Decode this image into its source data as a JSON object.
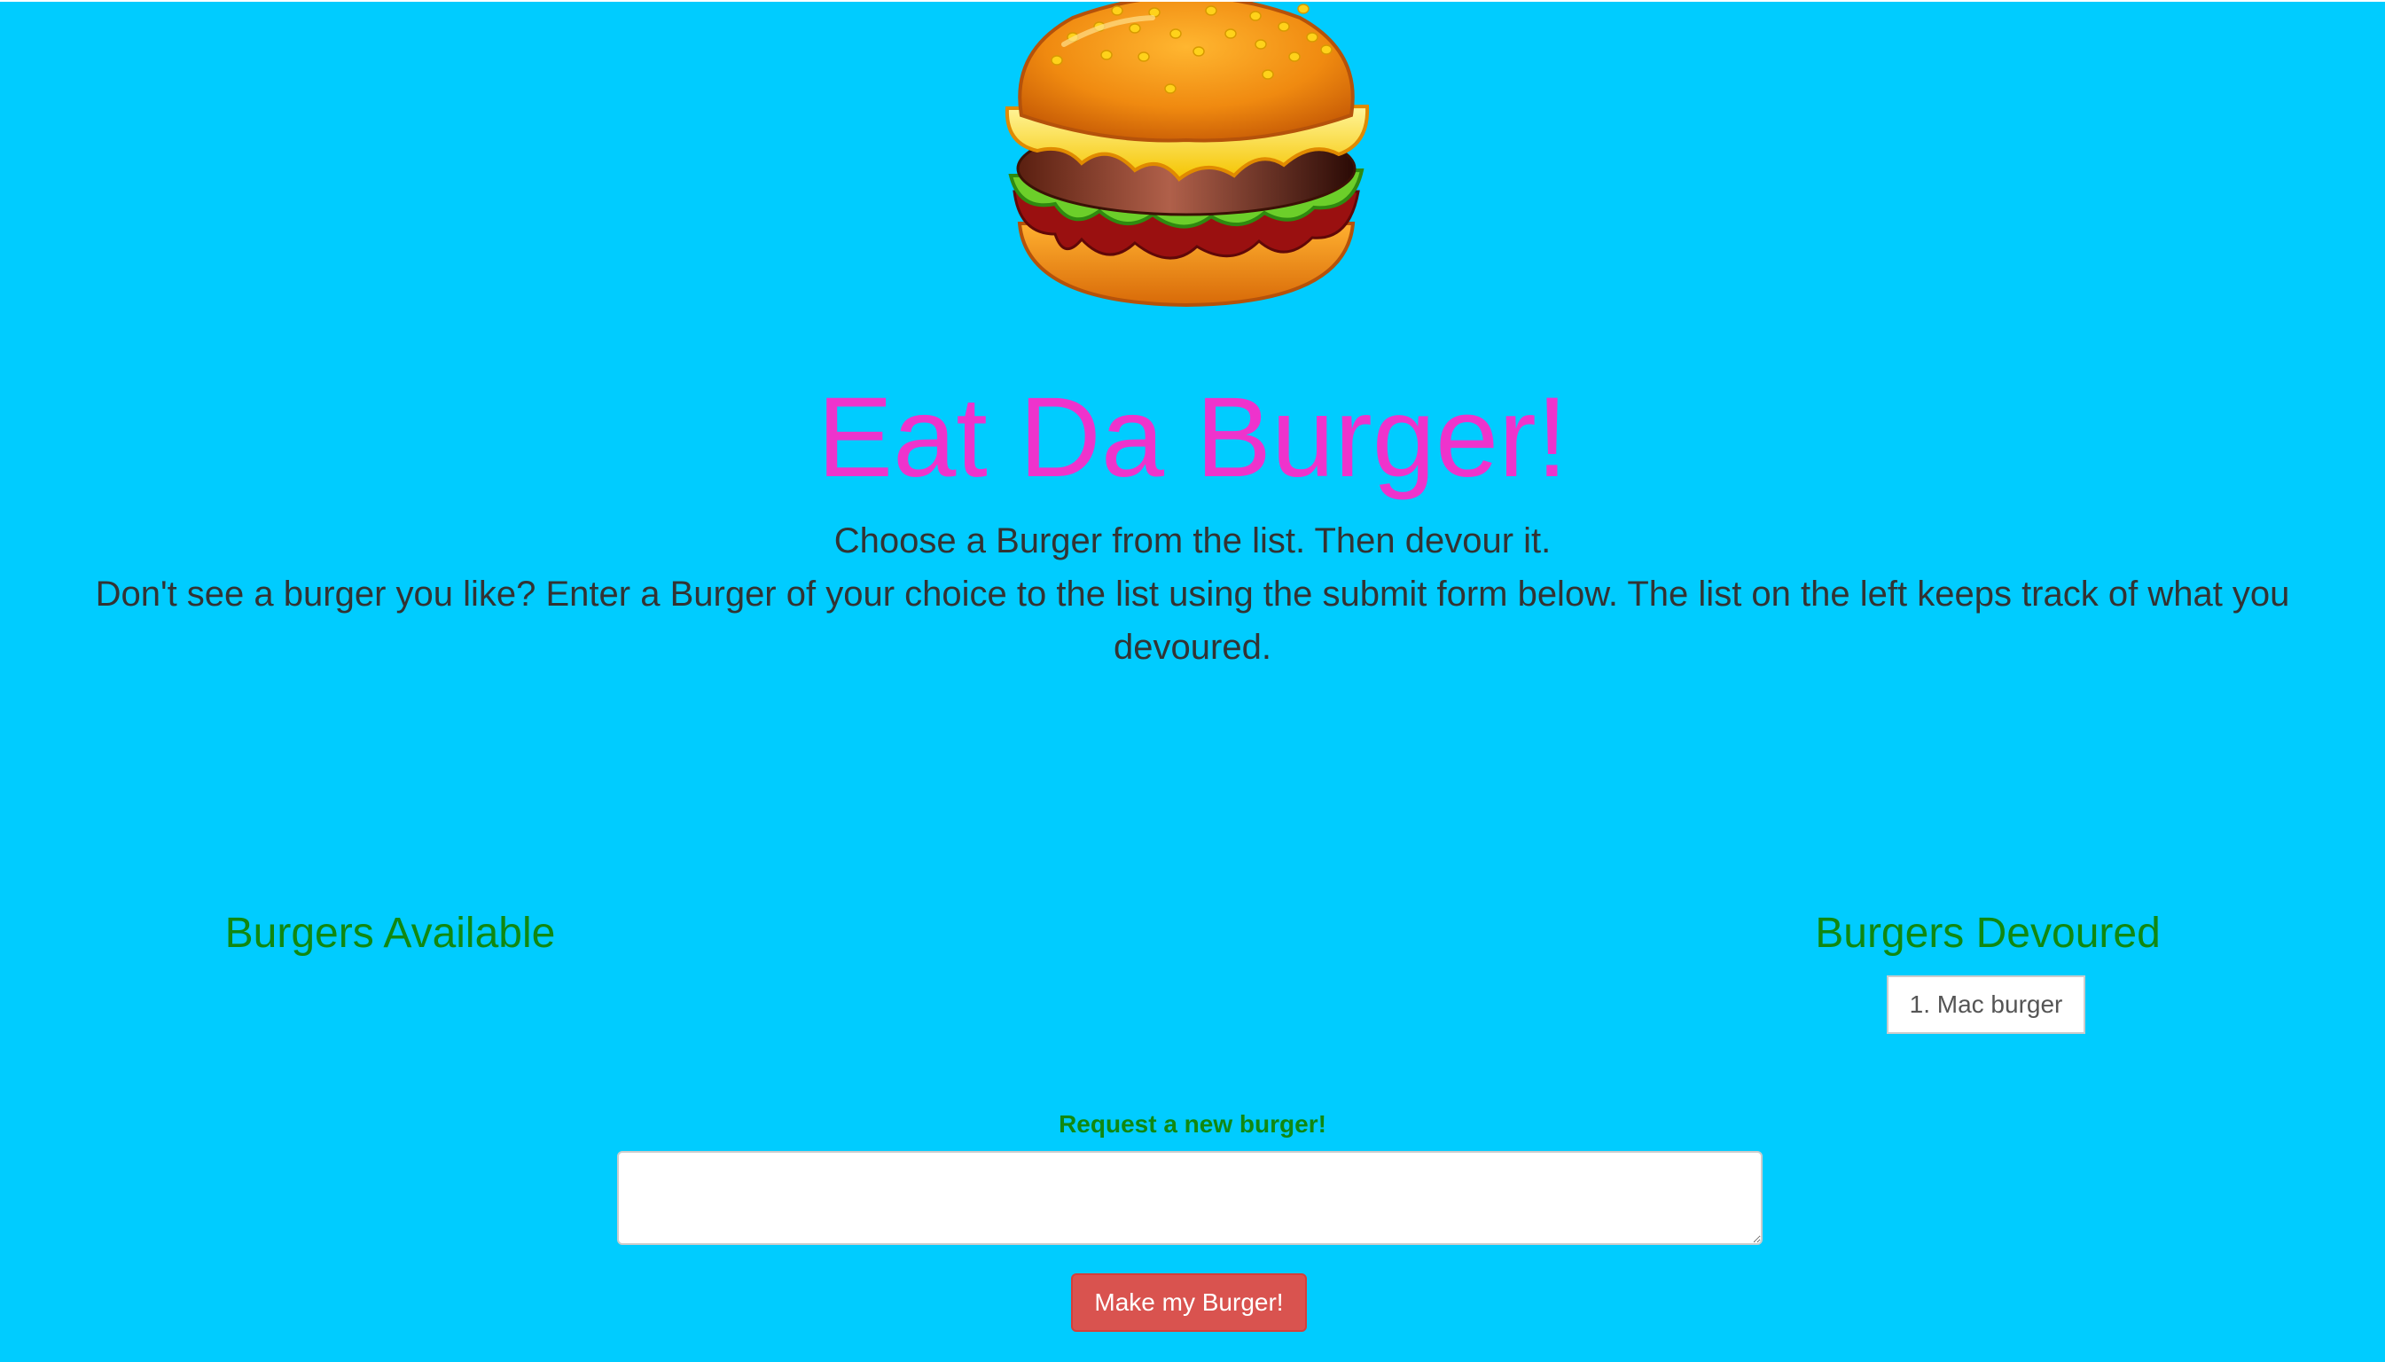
{
  "colors": {
    "background": "#00ccff",
    "title": "#ee33cc",
    "heading": "#118811",
    "button": "#d9534f"
  },
  "hero": {
    "icon": "burger-icon"
  },
  "header": {
    "title": "Eat Da Burger!",
    "intro_line1": "Choose a Burger from the list. Then devour it.",
    "intro_line2": "Don't see a burger you like? Enter a Burger of your choice to the list using the submit form below. The list on the left keeps track of what you devoured."
  },
  "available": {
    "heading": "Burgers Available",
    "items": []
  },
  "devoured": {
    "heading": "Burgers Devoured",
    "items": [
      {
        "label": "1. Mac burger"
      }
    ]
  },
  "form": {
    "label": "Request a new burger!",
    "input_value": "",
    "submit_label": "Make my Burger!"
  }
}
